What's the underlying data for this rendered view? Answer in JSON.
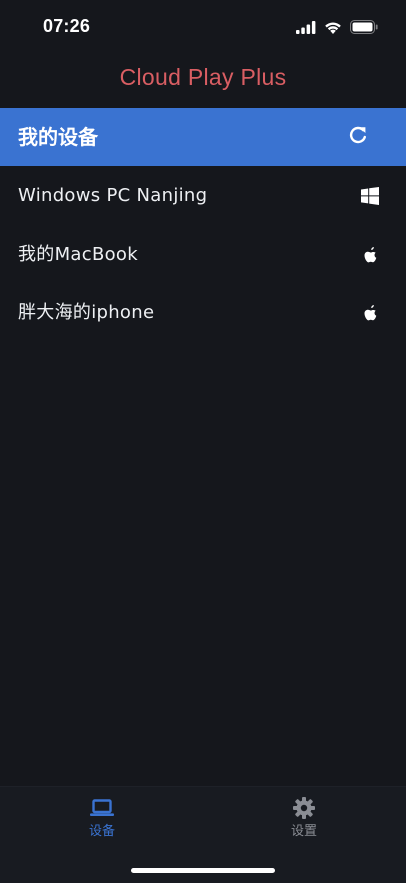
{
  "status_bar": {
    "time": "07:26",
    "icons": [
      "cellular-signal-icon",
      "wifi-icon",
      "battery-icon"
    ]
  },
  "app": {
    "title": "Cloud Play Plus",
    "title_color": "#d95e63",
    "accent_color": "#3a73d1"
  },
  "section": {
    "title": "我的设备",
    "action_icon": "refresh-icon"
  },
  "devices": [
    {
      "name": "Windows PC Nanjing",
      "icon": "windows-icon"
    },
    {
      "name": "我的MacBook",
      "icon": "apple-icon"
    },
    {
      "name": "胖大海的iphone",
      "icon": "apple-icon"
    }
  ],
  "bottom_nav": {
    "items": [
      {
        "label": "设备",
        "icon": "laptop-icon",
        "active": true,
        "color": "#3a73d1"
      },
      {
        "label": "设置",
        "icon": "gear-icon",
        "active": false,
        "color": "#8a8d94"
      }
    ]
  }
}
